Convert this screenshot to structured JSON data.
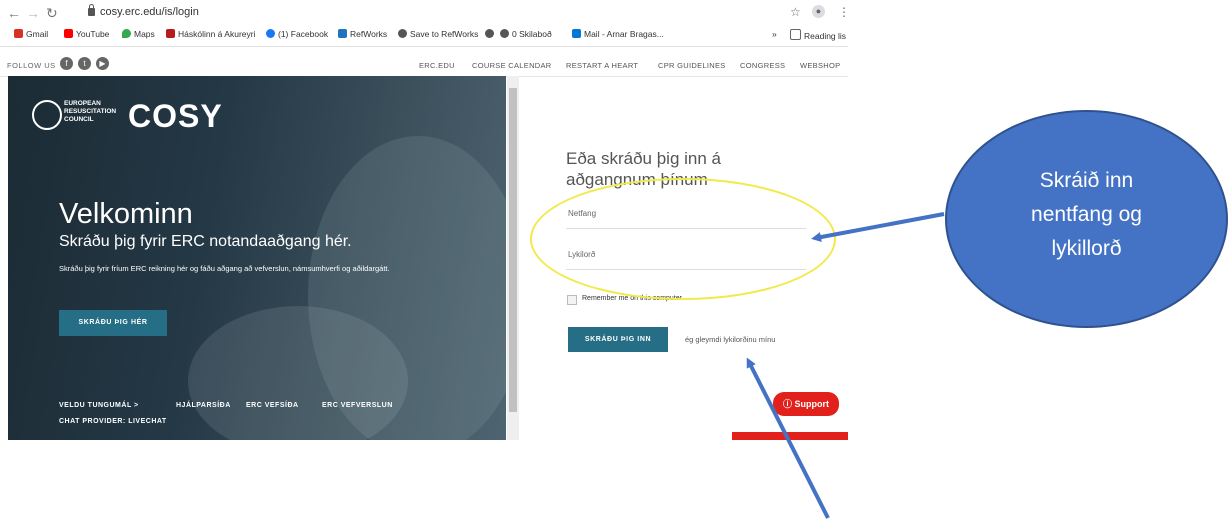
{
  "browser": {
    "url": "cosy.erc.edu/is/login",
    "bookmarks": [
      "Gmail",
      "YouTube",
      "Maps",
      "Háskólinn á Akureyri",
      "(1) Facebook",
      "RefWorks",
      "Save to RefWorks",
      "0 Skilaboð",
      "Mail - Arnar Bragas...",
      "Reading lis"
    ],
    "bookmark_colors": [
      "#d93025",
      "#ff0000",
      "#34a853",
      "#b71c1c",
      "#1877f2",
      "#1e73be",
      "#555555",
      "#555555",
      "#0078d4",
      "#666666"
    ],
    "overflow": "»"
  },
  "site": {
    "follow_us": "FOLLOW US",
    "nav": [
      "ERC.EDU",
      "COURSE CALENDAR",
      "RESTART A HEART",
      "CPR GUIDELINES",
      "CONGRESS",
      "WEBSHOP"
    ]
  },
  "hero": {
    "org_lines": [
      "EUROPEAN",
      "RESUSCITATION",
      "COUNCIL"
    ],
    "brand": "COSY",
    "welcome": "Velkominn",
    "subtitle": "Skráðu þig fyrir ERC notandaaðgang hér.",
    "description": "Skráðu þig fyrir fríum ERC reikning hér og fáðu aðgang að vefverslun, námsumhverfi og aðildargátt.",
    "register_button": "SKRÁÐU ÞIG HÉR",
    "footer_links": [
      "VELDU TUNGUMÁL >",
      "HJÁLPARSÍÐA",
      "ERC VEFSÍÐA",
      "ERC VEFVERSLUN"
    ],
    "chat_provider": "CHAT PROVIDER: LIVECHAT"
  },
  "login": {
    "title": "Eða skráðu þig inn á aðgangnum þínum",
    "email_label": "Netfang",
    "password_label": "Lykilorð",
    "remember_label": "Remember me on this computer",
    "login_button": "SKRÁÐU ÞIG INN",
    "forgot": "ég gleymdi lykilorðinu mínu",
    "support": "Support"
  },
  "annotation": {
    "callout_lines": [
      "Skráið inn",
      "nentfang og",
      "lykillorð"
    ],
    "color": "#4472c4",
    "highlight_color": "#f2e94a"
  }
}
